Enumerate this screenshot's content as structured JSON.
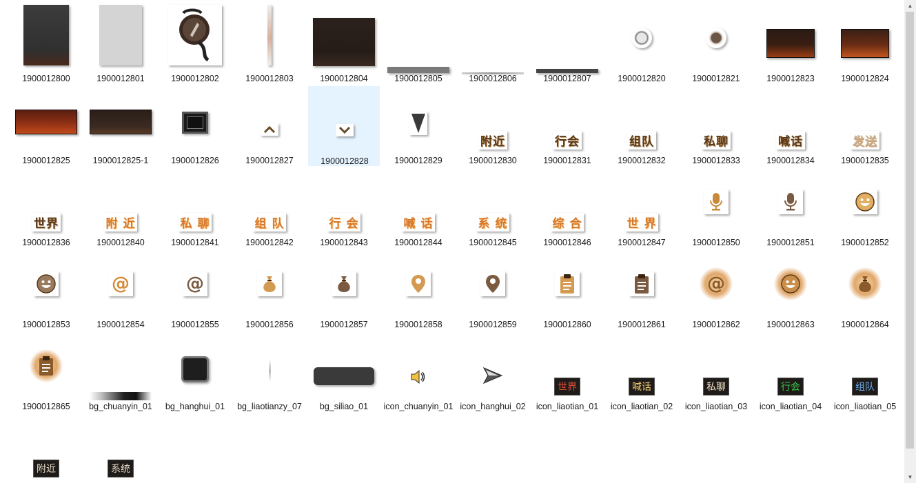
{
  "window": {
    "title": ""
  },
  "files": [
    {
      "name": "1900012800"
    },
    {
      "name": "1900012801"
    },
    {
      "name": "1900012802"
    },
    {
      "name": "1900012803"
    },
    {
      "name": "1900012804"
    },
    {
      "name": "1900012805"
    },
    {
      "name": "1900012806"
    },
    {
      "name": "1900012807"
    },
    {
      "name": "1900012820"
    },
    {
      "name": "1900012821"
    },
    {
      "name": "1900012823"
    },
    {
      "name": "1900012824"
    },
    {
      "name": "1900012825"
    },
    {
      "name": "1900012825-1"
    },
    {
      "name": "1900012826"
    },
    {
      "name": "1900012827"
    },
    {
      "name": "1900012828",
      "selected": true
    },
    {
      "name": "1900012829"
    },
    {
      "name": "1900012830",
      "text": "附近"
    },
    {
      "name": "1900012831",
      "text": "行会"
    },
    {
      "name": "1900012832",
      "text": "组队"
    },
    {
      "name": "1900012833",
      "text": "私聊"
    },
    {
      "name": "1900012834",
      "text": "喊话"
    },
    {
      "name": "1900012835",
      "text": "发送"
    },
    {
      "name": "1900012836",
      "text": "世界"
    },
    {
      "name": "1900012840",
      "text": "附 近"
    },
    {
      "name": "1900012841",
      "text": "私 聊"
    },
    {
      "name": "1900012842",
      "text": "组 队"
    },
    {
      "name": "1900012843",
      "text": "行 会"
    },
    {
      "name": "1900012844",
      "text": "喊 话"
    },
    {
      "name": "1900012845",
      "text": "系 统"
    },
    {
      "name": "1900012846",
      "text": "综 合"
    },
    {
      "name": "1900012847",
      "text": "世 界"
    },
    {
      "name": "1900012850"
    },
    {
      "name": "1900012851"
    },
    {
      "name": "1900012852"
    },
    {
      "name": "1900012853"
    },
    {
      "name": "1900012854"
    },
    {
      "name": "1900012855"
    },
    {
      "name": "1900012856"
    },
    {
      "name": "1900012857"
    },
    {
      "name": "1900012858"
    },
    {
      "name": "1900012859"
    },
    {
      "name": "1900012860"
    },
    {
      "name": "1900012861"
    },
    {
      "name": "1900012862"
    },
    {
      "name": "1900012863"
    },
    {
      "name": "1900012864"
    },
    {
      "name": "1900012865"
    },
    {
      "name": "bg_chuanyin_01"
    },
    {
      "name": "bg_hanghui_01"
    },
    {
      "name": "bg_liaotianzy_07"
    },
    {
      "name": "bg_siliao_01"
    },
    {
      "name": "icon_chuanyin_01"
    },
    {
      "name": "icon_hanghui_02"
    },
    {
      "name": "icon_liaotian_01",
      "text": "世界"
    },
    {
      "name": "icon_liaotian_02",
      "text": "喊话"
    },
    {
      "name": "icon_liaotian_03",
      "text": "私聊"
    },
    {
      "name": "icon_liaotian_04",
      "text": "行会"
    },
    {
      "name": "icon_liaotian_05",
      "text": "组队"
    },
    {
      "name": "",
      "text": "附近"
    },
    {
      "name": "",
      "text": "系统"
    }
  ]
}
